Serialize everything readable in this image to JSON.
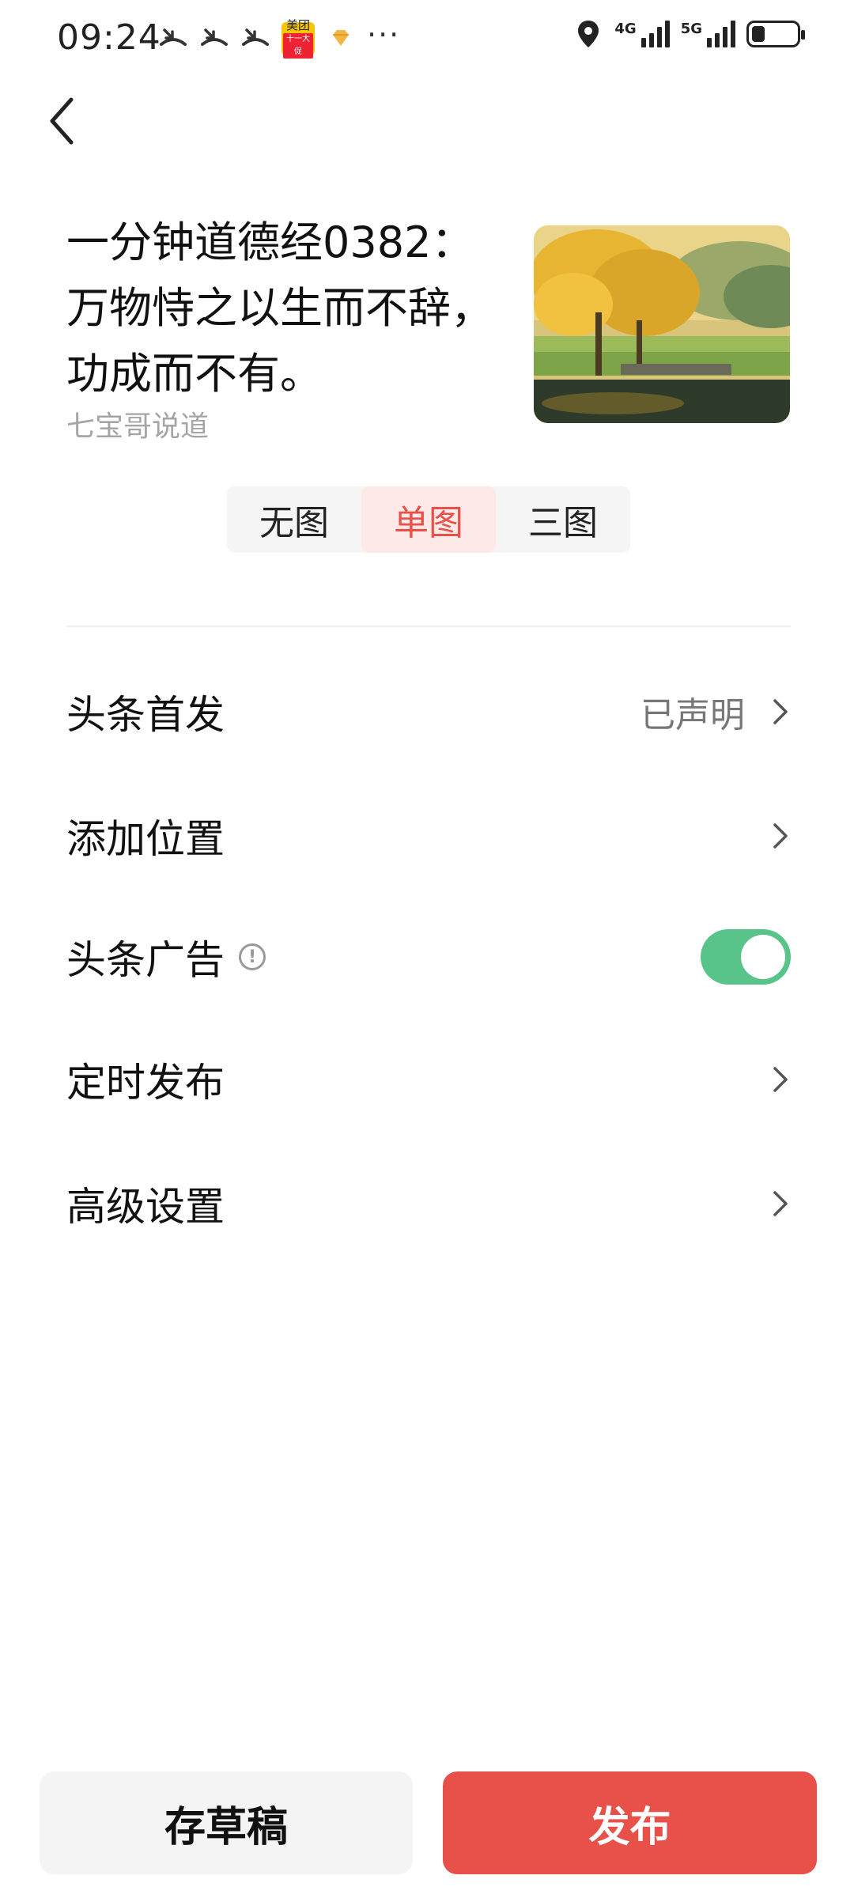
{
  "status_bar": {
    "time": "09:24",
    "meituan_label": "美团",
    "meituan_sub": "十一大促",
    "more": "···",
    "net1_label": "4G",
    "net2_label": "5G",
    "battery_level": 0.3
  },
  "article": {
    "title": "一分钟道德经0382：万物恃之以生而不辞，功成而不有。",
    "author": "七宝哥说道",
    "thumbnail_icon": "autumn-tree-landscape"
  },
  "cover_mode": {
    "options": [
      "无图",
      "单图",
      "三图"
    ],
    "selected": "单图"
  },
  "settings": {
    "first_publish": {
      "label": "头条首发",
      "value": "已声明"
    },
    "add_location": {
      "label": "添加位置"
    },
    "ads": {
      "label": "头条广告",
      "info_icon": "!",
      "enabled": true
    },
    "scheduled": {
      "label": "定时发布"
    },
    "advanced": {
      "label": "高级设置"
    }
  },
  "actions": {
    "save_draft": "存草稿",
    "publish": "发布"
  },
  "colors": {
    "accent": "#e8504a",
    "toggle_on": "#58c48a",
    "segment_active_bg": "#fde9e7"
  }
}
